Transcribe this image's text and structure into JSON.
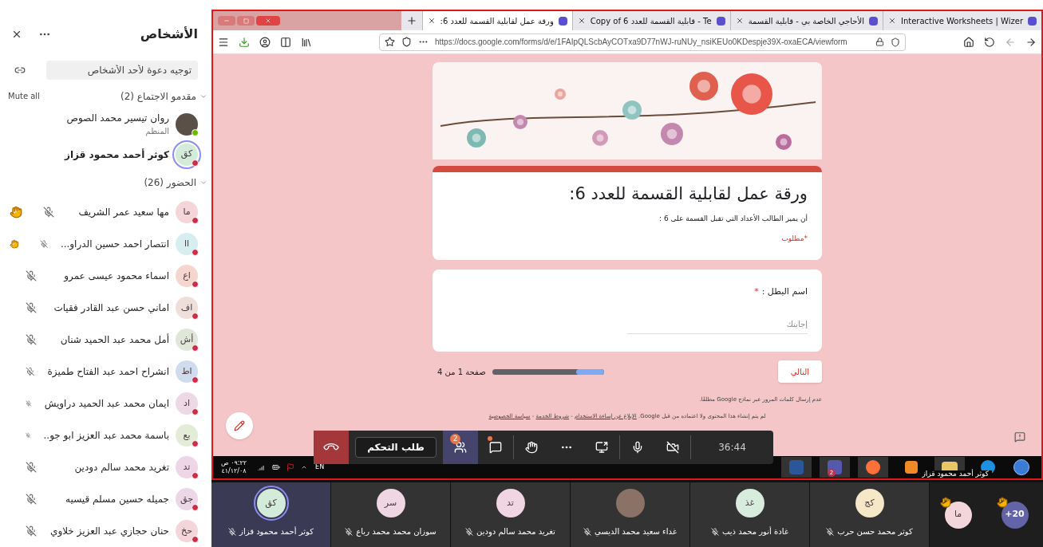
{
  "people_panel": {
    "title": "الأشخاص",
    "invite_placeholder": "توجيه دعوة لأحد الأشخاص",
    "presenters": {
      "label": "مقدمو الاجتماع (2)",
      "expanded": true,
      "mute_all": "Mute all",
      "people": [
        {
          "kind": "photo",
          "name": "روان تيسير محمد الصوص",
          "role": "المنظم",
          "is_you": false
        },
        {
          "kind": "initials",
          "initials": "كق",
          "color": "#d3ecd9",
          "name": "كوثر أحمد محمود قزاز",
          "is_you": true
        }
      ]
    },
    "attendees": {
      "label": "الحضور (26)",
      "expanded": true,
      "people": [
        {
          "initials": "ما",
          "color": "#f5d5d8",
          "name": "مها سعيد عمر الشريف",
          "hand_raised": true
        },
        {
          "initials": "اا",
          "color": "#d6eef0",
          "name": "انتصار احمد حسين الدراو...",
          "hand_raised": true
        },
        {
          "initials": "اع",
          "color": "#f5d6cf",
          "name": "اسماء محمود عيسى عمرو",
          "hand_raised": false
        },
        {
          "initials": "اف",
          "color": "#eedfdb",
          "name": "اماني حسن عبد القادر فقيات",
          "hand_raised": false
        },
        {
          "initials": "أش",
          "color": "#dfe7d9",
          "name": "أمل محمد عبد الحميد شنان",
          "hand_raised": false
        },
        {
          "initials": "اط",
          "color": "#cfdcee",
          "name": "انشراح احمد عبد الفتاح طميزة",
          "hand_raised": false
        },
        {
          "initials": "اد",
          "color": "#eed8e6",
          "name": "ايمان محمد عبد الحميد دراويش",
          "hand_raised": false
        },
        {
          "initials": "بع",
          "color": "#e2ecd6",
          "name": "باسمة محمد عبد العزيز ابو جو..",
          "hand_raised": false
        },
        {
          "initials": "تد",
          "color": "#eed6e6",
          "name": "تغريد محمد سالم دودين",
          "hand_raised": false
        },
        {
          "initials": "جق",
          "color": "#ebd7e6",
          "name": "جميله حسين مسلم قيسيه",
          "hand_raised": false
        },
        {
          "initials": "حخ",
          "color": "#f4d6da",
          "name": "حنان حجازي عبد العزيز خلاوي",
          "hand_raised": false
        }
      ]
    }
  },
  "browser": {
    "tabs": [
      {
        "title": "Interactive Worksheets | Wizer",
        "selected": false
      },
      {
        "title": "الأحاجي الخاصة بي - قابلية القسمة",
        "selected": false
      },
      {
        "title": "Copy of 6 قابلية القسمة للعدد - Te",
        "selected": false
      },
      {
        "title": "ورقة عمل لقابلية القسمة للعدد 6:",
        "selected": true
      }
    ],
    "url": "https://docs.google.com/forms/d/e/1FAIpQLScbAyCOTxa9D77nWJ-ruNUy_nsiKEUo0KDespje39X-oxaECA/viewform",
    "form": {
      "title": "ورقة عمل لقابلية القسمة للعدد 6:",
      "description": "أن يميز الطالب الأعداد التي تقبل القسمة على 6 :",
      "required_note": "*مطلوب",
      "question": {
        "label": "اسم البطل :",
        "required_mark": "*",
        "placeholder": "إجابتك"
      },
      "next_button": "التالي",
      "progress": {
        "level": 0.25,
        "label": "صفحة 1 من 4"
      },
      "warning": "عدم إرسال كلمات المرور عبر نماذج Google مطلقًا.",
      "disclaimer": "لم يتم إنشاء هذا المحتوى ولا اعتماده من قبل Google.",
      "links": [
        "الإبلاغ عن إساءة الاستخدام",
        "شروط الخدمة",
        "سياسة الخصوصية"
      ],
      "link_separator": "-"
    }
  },
  "call_controls": {
    "request_control": "طلب التحكم",
    "people_badge": "2",
    "timer": "36:44"
  },
  "taskbar": {
    "time": "٠٩:٢٢ ص",
    "date": "٤١/١٢/٠٨",
    "language": "EN",
    "teams_badge": "2",
    "sharer": "كوثر أحمد محمود قزاز"
  },
  "video_strip": {
    "overflow": [
      {
        "kind": "count",
        "initials": "20+",
        "color": "#6264a7",
        "hand_raised": true
      },
      {
        "kind": "initials",
        "initials": "ما",
        "color": "#f3d6d9",
        "hand_raised": true
      }
    ],
    "tiles": [
      {
        "kind": "initials",
        "initials": "كج",
        "color": "#f6e7c8",
        "name": "كوثر محمد حسن حرب",
        "selected": false
      },
      {
        "kind": "initials",
        "initials": "غذ",
        "color": "#d7ecdc",
        "name": "غادة أنور محمد ذيب",
        "selected": false
      },
      {
        "kind": "photo",
        "name": "غداء سعيد محمد الديسي",
        "selected": false
      },
      {
        "kind": "initials",
        "initials": "تد",
        "color": "#f0d6e2",
        "name": "تغريد محمد سالم دودين",
        "selected": false
      },
      {
        "kind": "initials",
        "initials": "سر",
        "color": "#f0d6e2",
        "name": "سوزان محمد محمد رباع",
        "selected": false
      },
      {
        "kind": "initials",
        "initials": "كق",
        "color": "#d3ecd9",
        "name": "كوثر أحمد محمود قزاز",
        "selected": true
      }
    ]
  }
}
